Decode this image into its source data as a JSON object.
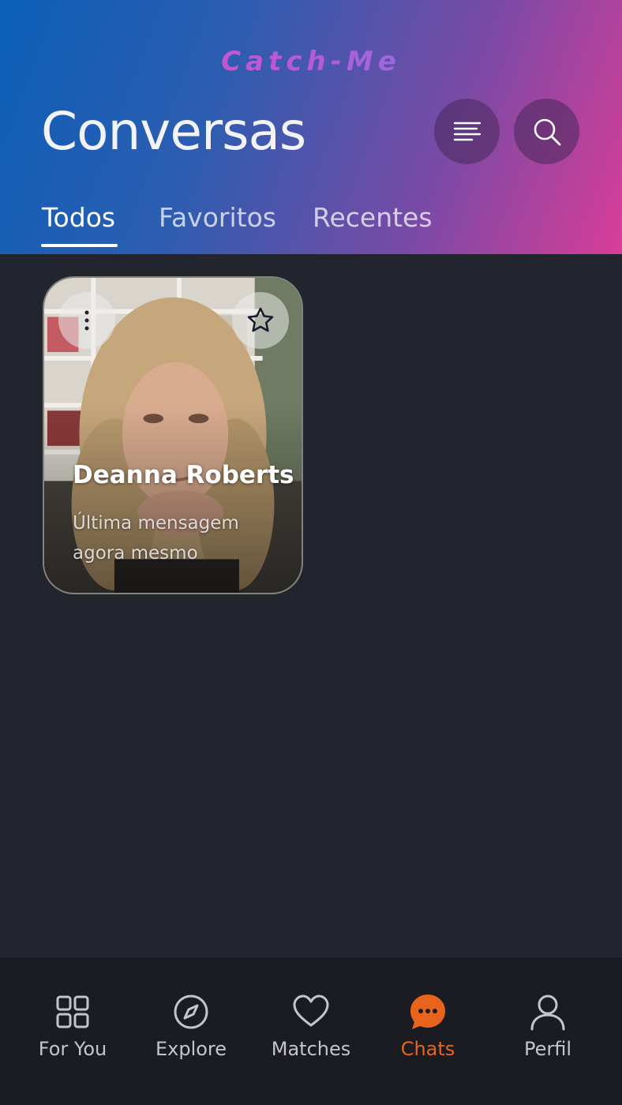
{
  "header": {
    "logo": "Catch-Me",
    "title": "Conversas",
    "sort_icon": "sort-lines-icon",
    "search_icon": "search-icon"
  },
  "tabs": [
    {
      "label": "Todos",
      "active": true
    },
    {
      "label": "Favoritos",
      "active": false
    },
    {
      "label": "Recentes",
      "active": false
    }
  ],
  "chats": [
    {
      "name": "Deanna Roberts",
      "message": "Última mensagem agora mesmo",
      "menu_icon": "vertical-dots-icon",
      "favorite_icon": "star-outline-icon"
    }
  ],
  "bottom_nav": [
    {
      "label": "For You",
      "icon": "grid-icon",
      "active": false
    },
    {
      "label": "Explore",
      "icon": "compass-icon",
      "active": false
    },
    {
      "label": "Matches",
      "icon": "heart-icon",
      "active": false
    },
    {
      "label": "Chats",
      "icon": "chat-bubble-icon",
      "active": true
    },
    {
      "label": "Perfil",
      "icon": "user-icon",
      "active": false
    }
  ],
  "colors": {
    "accent": "#e8641c",
    "background": "#23252e",
    "nav_background": "#1b1c22"
  }
}
